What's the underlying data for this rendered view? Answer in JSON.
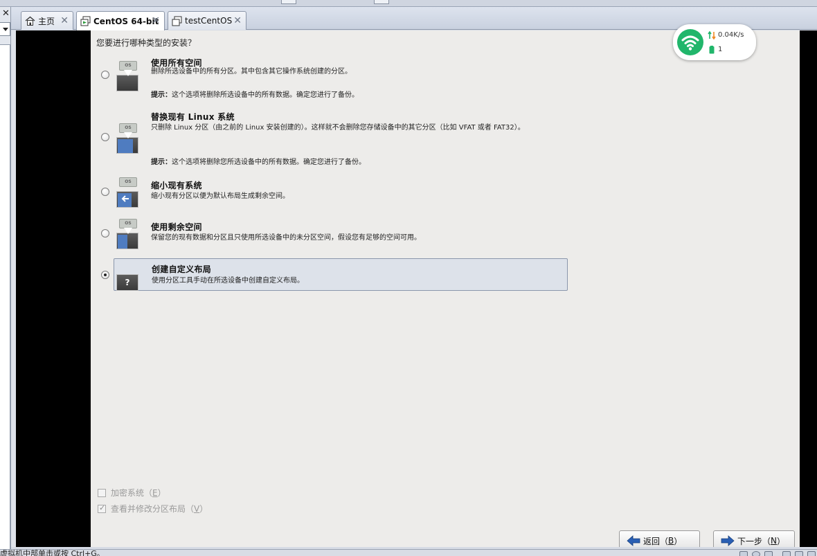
{
  "window": {
    "tabs": [
      {
        "label": "主页",
        "active": false,
        "icon": "home-icon"
      },
      {
        "label": "CentOS 64-bit",
        "active": true,
        "icon": "vm-running-icon"
      },
      {
        "label": "testCentOS",
        "active": false,
        "icon": "vm-icon"
      }
    ],
    "tab_close_glyph": "✕",
    "sidebar_close_glyph": "✕"
  },
  "installer": {
    "question": "您要进行哪种类型的安装？",
    "options": [
      {
        "title": "使用所有空间",
        "desc": "删除所选设备中的所有分区。其中包含其它操作系统创建的分区。",
        "hint_label": "提示：",
        "hint_text": "这个选项将删除所选设备中的所有数据。确定您进行了备份。",
        "selected": false,
        "icon": "disk-erase-all-icon"
      },
      {
        "title": "替换现有 Linux 系统",
        "desc": "只删除 Linux 分区（由之前的 Linux 安装创建的）。这样就不会删除您存储设备中的其它分区（比如 VFAT 或者 FAT32）。",
        "hint_label": "提示：",
        "hint_text": "这个选项将删除您所选设备中的所有数据。确定您进行了备份。",
        "selected": false,
        "icon": "disk-replace-linux-icon"
      },
      {
        "title": "缩小现有系统",
        "desc": "缩小现有分区以便为默认布局生成剩余空间。",
        "selected": false,
        "icon": "disk-shrink-icon"
      },
      {
        "title": "使用剩余空间",
        "desc": "保留您的现有数据和分区且只使用所选设备中的未分区空间，假设您有足够的空间可用。",
        "selected": false,
        "icon": "disk-free-space-icon"
      },
      {
        "title": "创建自定义布局",
        "desc": "使用分区工具手动在所选设备中创建自定义布局。",
        "selected": true,
        "icon": "disk-custom-layout-icon",
        "icon_glyph": "?"
      }
    ],
    "disk_tag": "OS",
    "checkboxes": [
      {
        "label": "加密系统（",
        "mnemonic": "E",
        "suffix": "）",
        "checked": false,
        "enabled": false
      },
      {
        "label": "查看并修改分区布局（",
        "mnemonic": "V",
        "suffix": "）",
        "checked": true,
        "enabled": false
      }
    ],
    "buttons": {
      "back": {
        "label": "返回（",
        "mnemonic": "B",
        "suffix": "）",
        "icon": "arrow-left-icon"
      },
      "next": {
        "label": "下一步（",
        "mnemonic": "N",
        "suffix": "）",
        "icon": "arrow-right-icon"
      }
    }
  },
  "wifi": {
    "speed": "0.04K/s",
    "devices": "1",
    "color": "#21b66b"
  },
  "statusbar": {
    "text": "虚拟机中部单击或按 Ctrl+G。"
  },
  "colors": {
    "accent_blue": "#4f7cc0",
    "selection_bg": "#dde2ea",
    "screen_bg": "#edecea"
  }
}
